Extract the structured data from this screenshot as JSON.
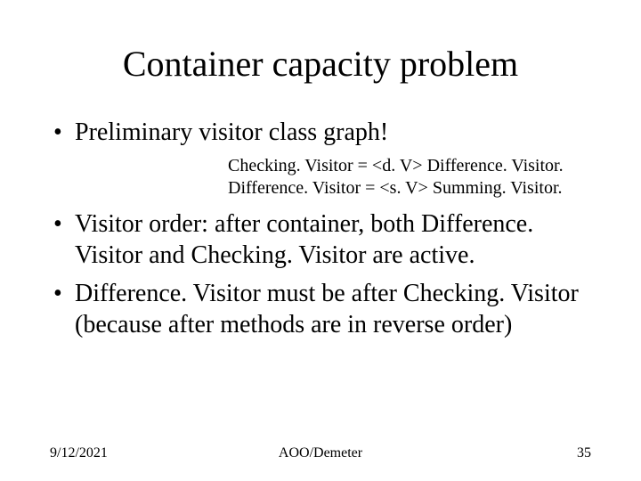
{
  "title": "Container capacity problem",
  "bullets": {
    "b1": "Preliminary visitor class graph!",
    "code1": "Checking. Visitor = <d. V> Difference. Visitor.",
    "code2": "Difference. Visitor = <s. V> Summing. Visitor.",
    "b2": "Visitor order: after container, both Difference. Visitor and Checking. Visitor are active.",
    "b3": "Difference. Visitor must be after Checking. Visitor (because after methods are in reverse order)"
  },
  "footer": {
    "date": "9/12/2021",
    "center": "AOO/Demeter",
    "page": "35"
  }
}
